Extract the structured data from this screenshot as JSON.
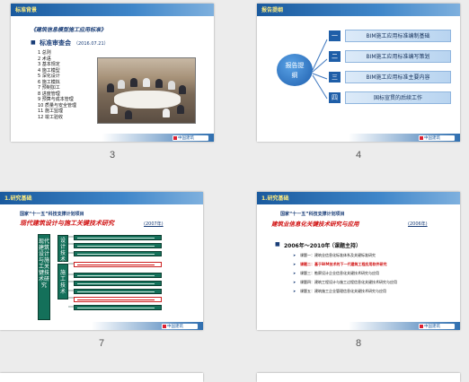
{
  "slides": [
    {
      "number": "3",
      "header": "标准背景",
      "title": "《建筑信息模型施工应用标准》",
      "subtitle": "标准审查会",
      "date": "（2016.07.21）",
      "list": [
        "1 总则",
        "2 术语",
        "3 基本规定",
        "4 施工模型",
        "5 深化设计",
        "6 施工模拟",
        "7 预制加工",
        "8 进度管理",
        "9 预算与成本管理",
        "10 质量与安全管理",
        "11 施工监理",
        "12 竣工验收"
      ],
      "footer_logo": "中国建筑"
    },
    {
      "number": "4",
      "header": "报告提纲",
      "center_label": "报告提纲",
      "items": [
        {
          "index": "一",
          "label": "BIM施工应用标准编制基础"
        },
        {
          "index": "二",
          "label": "BIM施工应用标准编写策划"
        },
        {
          "index": "三",
          "label": "BIM施工应用标准主要内容"
        },
        {
          "index": "四",
          "label": "国标宣贯的后续工作"
        }
      ],
      "footer_logo": "中国建筑"
    },
    {
      "number": "7",
      "header": "1.研究基础",
      "project_note": "国家“十一五”科技支撑计划项目",
      "title": "现代建筑设计与施工关键技术研究",
      "year_tag": "(2007年)",
      "left_box": "现代建筑设计与施工关键技术研究",
      "boxes": [
        "设计技术",
        "施工技术"
      ],
      "footer_logo": "中国建筑"
    },
    {
      "number": "8",
      "header": "1.研究基础",
      "project_note": "国家“十一五”科技支撑计划项目",
      "title": "建筑业信息化关键技术研究与应用",
      "year_tag": "(2006年)",
      "period": "2006年～2010年",
      "lead": "（课题主持）",
      "topics": [
        "课题一：建筑业信息化标准体系及关键标准研究",
        "课题二：基于BIM技术的下一代建筑工程应用软件研究",
        "课题三：勘察设计企业信息化关键技术研究与应用",
        "课题四：建筑工程设计与施工过程信息化关键技术研究与应用",
        "课题五：建筑施工企业管理信息化关键技术研究与应用"
      ],
      "footer_logo": "中国建筑"
    }
  ]
}
